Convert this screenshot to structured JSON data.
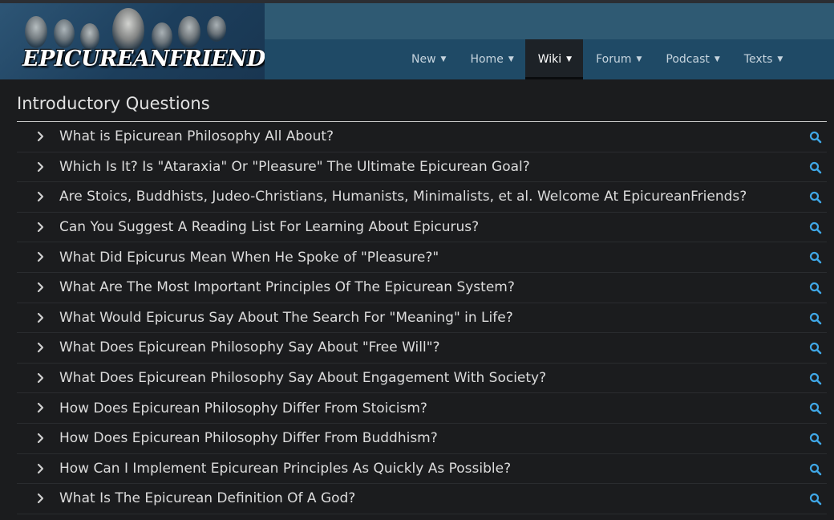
{
  "site": {
    "logo_text": "EPICUREANFRIENDS.COM"
  },
  "nav": {
    "items": [
      {
        "label": "New",
        "active": false
      },
      {
        "label": "Home",
        "active": false
      },
      {
        "label": "Wiki",
        "active": true
      },
      {
        "label": "Forum",
        "active": false
      },
      {
        "label": "Podcast",
        "active": false
      },
      {
        "label": "Texts",
        "active": false
      }
    ]
  },
  "section": {
    "title": "Introductory Questions"
  },
  "questions": [
    "What is Epicurean Philosophy All About?",
    "Which Is It? Is \"Ataraxia\" Or \"Pleasure\" The Ultimate Epicurean Goal?",
    "Are Stoics, Buddhists, Judeo-Christians, Humanists, Minimalists, et al. Welcome At EpicureanFriends?",
    "Can You Suggest A Reading List For Learning About Epicurus?",
    "What Did Epicurus Mean When He Spoke of \"Pleasure?\"",
    "What Are The Most Important Principles Of The Epicurean System?",
    "What Would Epicurus Say About The Search For \"Meaning\" in Life?",
    "What Does Epicurean Philosophy Say About \"Free Will\"?",
    "What Does Epicurean Philosophy Say About Engagement With Society?",
    "How Does Epicurean Philosophy Differ From Stoicism?",
    "How Does Epicurean Philosophy Differ From Buddhism?",
    "How Can I Implement Epicurean Principles As Quickly As Possible?",
    "What Is The Epicurean Definition Of A God?"
  ],
  "colors": {
    "accent": "#3fa7e6",
    "header": "#2f5a73",
    "nav_bg": "#1f4a66",
    "body_bg": "#1b1c1e"
  }
}
